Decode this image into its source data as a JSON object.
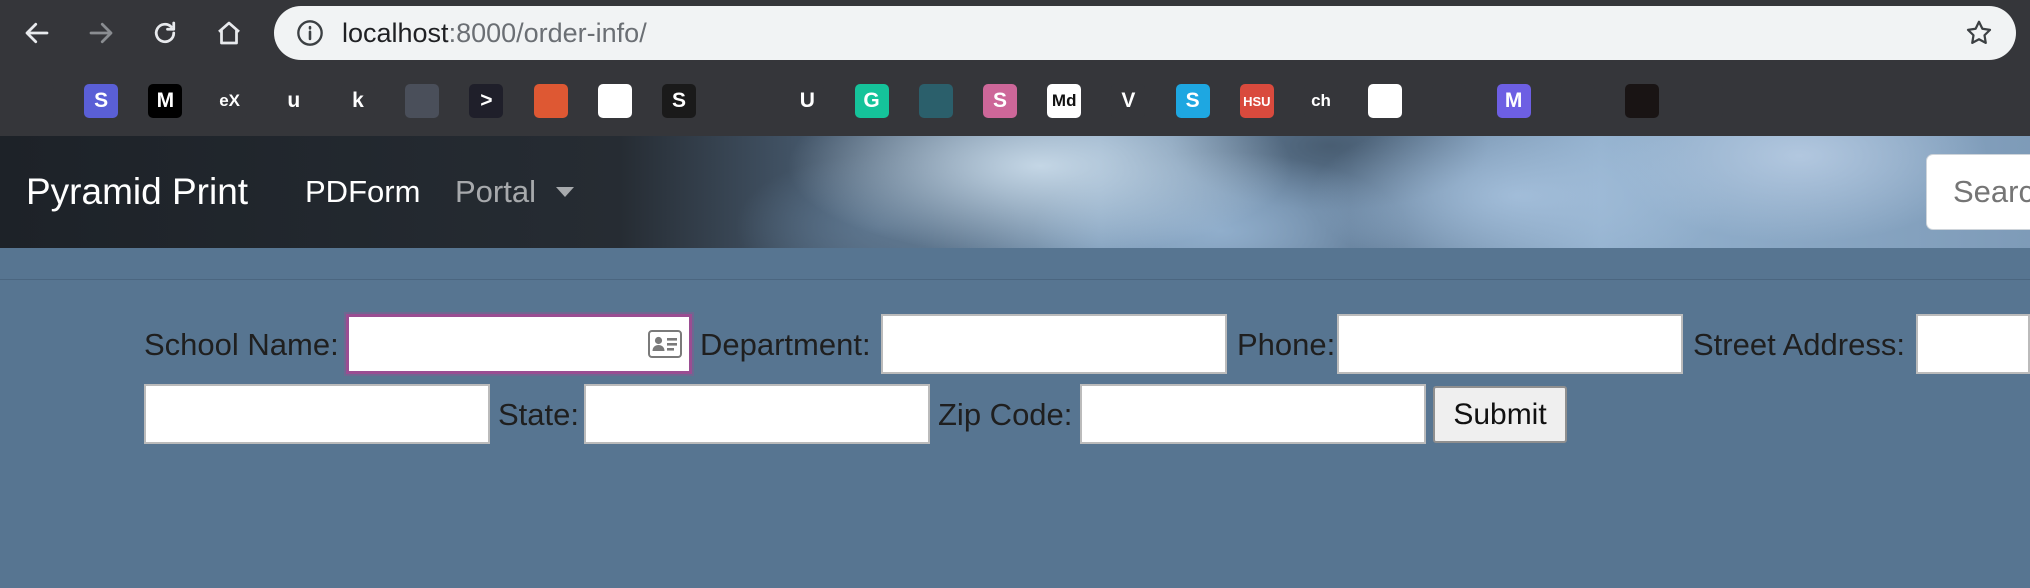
{
  "browser": {
    "url_host": "localhost",
    "url_rest": ":8000/order-info/",
    "bookmarks": [
      {
        "name": "airtable-icon",
        "label": "",
        "bg": "#35363a"
      },
      {
        "name": "stackedit-icon",
        "label": "S",
        "bg": "#5a5fd6"
      },
      {
        "name": "medium-icon",
        "label": "M",
        "bg": "#000000"
      },
      {
        "name": "edx-icon",
        "label": "eX",
        "bg": "#35363a"
      },
      {
        "name": "udemy-icon",
        "label": "u",
        "bg": "#35363a"
      },
      {
        "name": "khan-icon",
        "label": "k",
        "bg": "#35363a"
      },
      {
        "name": "rocket-icon",
        "label": "",
        "bg": "#4a4f5a"
      },
      {
        "name": "terminal-icon",
        "label": ">",
        "bg": "#1f1f2a"
      },
      {
        "name": "duckduckgo-icon",
        "label": "",
        "bg": "#de5833"
      },
      {
        "name": "crown-icon",
        "label": "",
        "bg": "#ffffff"
      },
      {
        "name": "s-box-icon",
        "label": "S",
        "bg": "#1a1a1a"
      },
      {
        "name": "hexagon-icon",
        "label": "",
        "bg": "#35363a"
      },
      {
        "name": "udacity-icon",
        "label": "U",
        "bg": "#35363a"
      },
      {
        "name": "grammarly-icon",
        "label": "G",
        "bg": "#15c39a"
      },
      {
        "name": "bird-icon",
        "label": "",
        "bg": "#2b5f6b"
      },
      {
        "name": "sass-icon",
        "label": "S",
        "bg": "#cd6799"
      },
      {
        "name": "markdown-icon",
        "label": "Md",
        "bg": "#ffffff"
      },
      {
        "name": "vue-icon",
        "label": "V",
        "bg": "#35363a"
      },
      {
        "name": "s-blue-icon",
        "label": "S",
        "bg": "#1ea7e1"
      },
      {
        "name": "hsu-icon",
        "label": "HSU",
        "bg": "#d94a3d"
      },
      {
        "name": "ch-icon",
        "label": "ch",
        "bg": "#35363a"
      },
      {
        "name": "chrome-icon",
        "label": "",
        "bg": "#ffffff"
      },
      {
        "name": "analytics-icon",
        "label": "",
        "bg": "#35363a"
      },
      {
        "name": "mastodon-icon",
        "label": "M",
        "bg": "#6d5fe3"
      },
      {
        "name": "parallelogram-icon",
        "label": "",
        "bg": "#35363a"
      },
      {
        "name": "spotify-icon",
        "label": "",
        "bg": "#191414"
      },
      {
        "name": "ring-icon",
        "label": "",
        "bg": "#35363a"
      }
    ]
  },
  "navbar": {
    "brand": "Pyramid Print",
    "links": [
      "PDForm",
      "Portal"
    ],
    "search_placeholder": "Search"
  },
  "form": {
    "labels": {
      "school_name": "School Name:",
      "department": "Department:",
      "phone": "Phone:",
      "street_address": "Street Address:",
      "state": "State:",
      "zip_code": "Zip Code:"
    },
    "values": {
      "school_name": "",
      "department": "",
      "phone": "",
      "street_address": "",
      "city": "",
      "state": "",
      "zip_code": ""
    },
    "submit_label": "Submit",
    "focused_field": "school_name",
    "focus_color": "#9a4d92"
  }
}
